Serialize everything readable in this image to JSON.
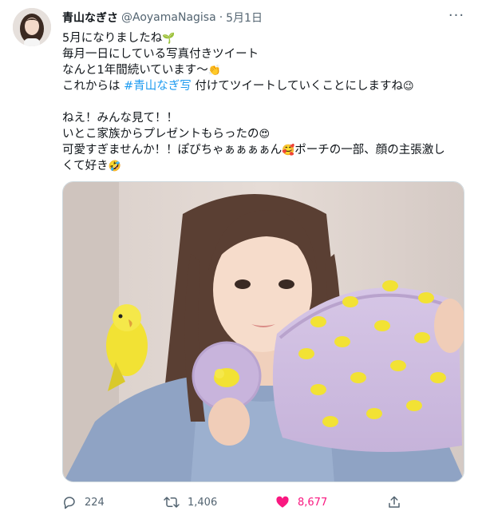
{
  "tweet": {
    "author_name": "青山なぎさ",
    "handle": "@AoyamaNagisa",
    "separator": "·",
    "date": "5月1日",
    "more_label": "···",
    "lines": [
      {
        "before": "5月になりましたね",
        "emoji": "🌱"
      },
      {
        "text": "毎月一日にしている写真付きツイート"
      },
      {
        "before": "なんと1年間続いています〜",
        "emoji": "👏"
      },
      {
        "before": "これからは ",
        "hashtag": "#青山なぎ写",
        "after": " 付けてツイートしていくことにしますね",
        "emoji": "😉"
      },
      {
        "text": "ねえ！みんな見て！！"
      },
      {
        "before": "いとこ家族からプレゼントもらったの",
        "emoji": "😍"
      },
      {
        "before": "可愛すぎませんか！！ぽぴちゃぁぁぁぁん",
        "emoji": "🥰",
        "after": "ポーチの一部、顔の主張激し"
      },
      {
        "before": "くて好き",
        "emoji": "🤣"
      }
    ]
  },
  "actions": {
    "reply_count": "224",
    "retweet_count": "1,406",
    "like_count": "8,677",
    "like_color": "#f91880",
    "icons": [
      "reply-icon",
      "retweet-icon",
      "like-icon",
      "share-icon"
    ]
  },
  "colors": {
    "link": "#1d9bf0",
    "secondary_text": "#536471",
    "media_border": "#cfd9de"
  }
}
